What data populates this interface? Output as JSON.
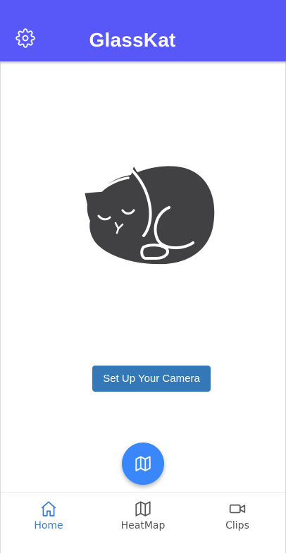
{
  "header": {
    "title": "GlassKat",
    "settings_icon": "gear-icon",
    "background_color": "#5858f8"
  },
  "main": {
    "logo_icon": "sleeping-cat-icon",
    "setup_button_label": "Set Up Your Camera",
    "setup_button_color": "#3478b8"
  },
  "fab": {
    "icon": "map-icon",
    "color": "#3a86fb"
  },
  "bottom_nav": {
    "items": [
      {
        "label": "Home",
        "icon": "home-icon",
        "active": true
      },
      {
        "label": "HeatMap",
        "icon": "map-icon",
        "active": false
      },
      {
        "label": "Clips",
        "icon": "video-camera-icon",
        "active": false
      }
    ],
    "active_color": "#3a7bd5"
  }
}
